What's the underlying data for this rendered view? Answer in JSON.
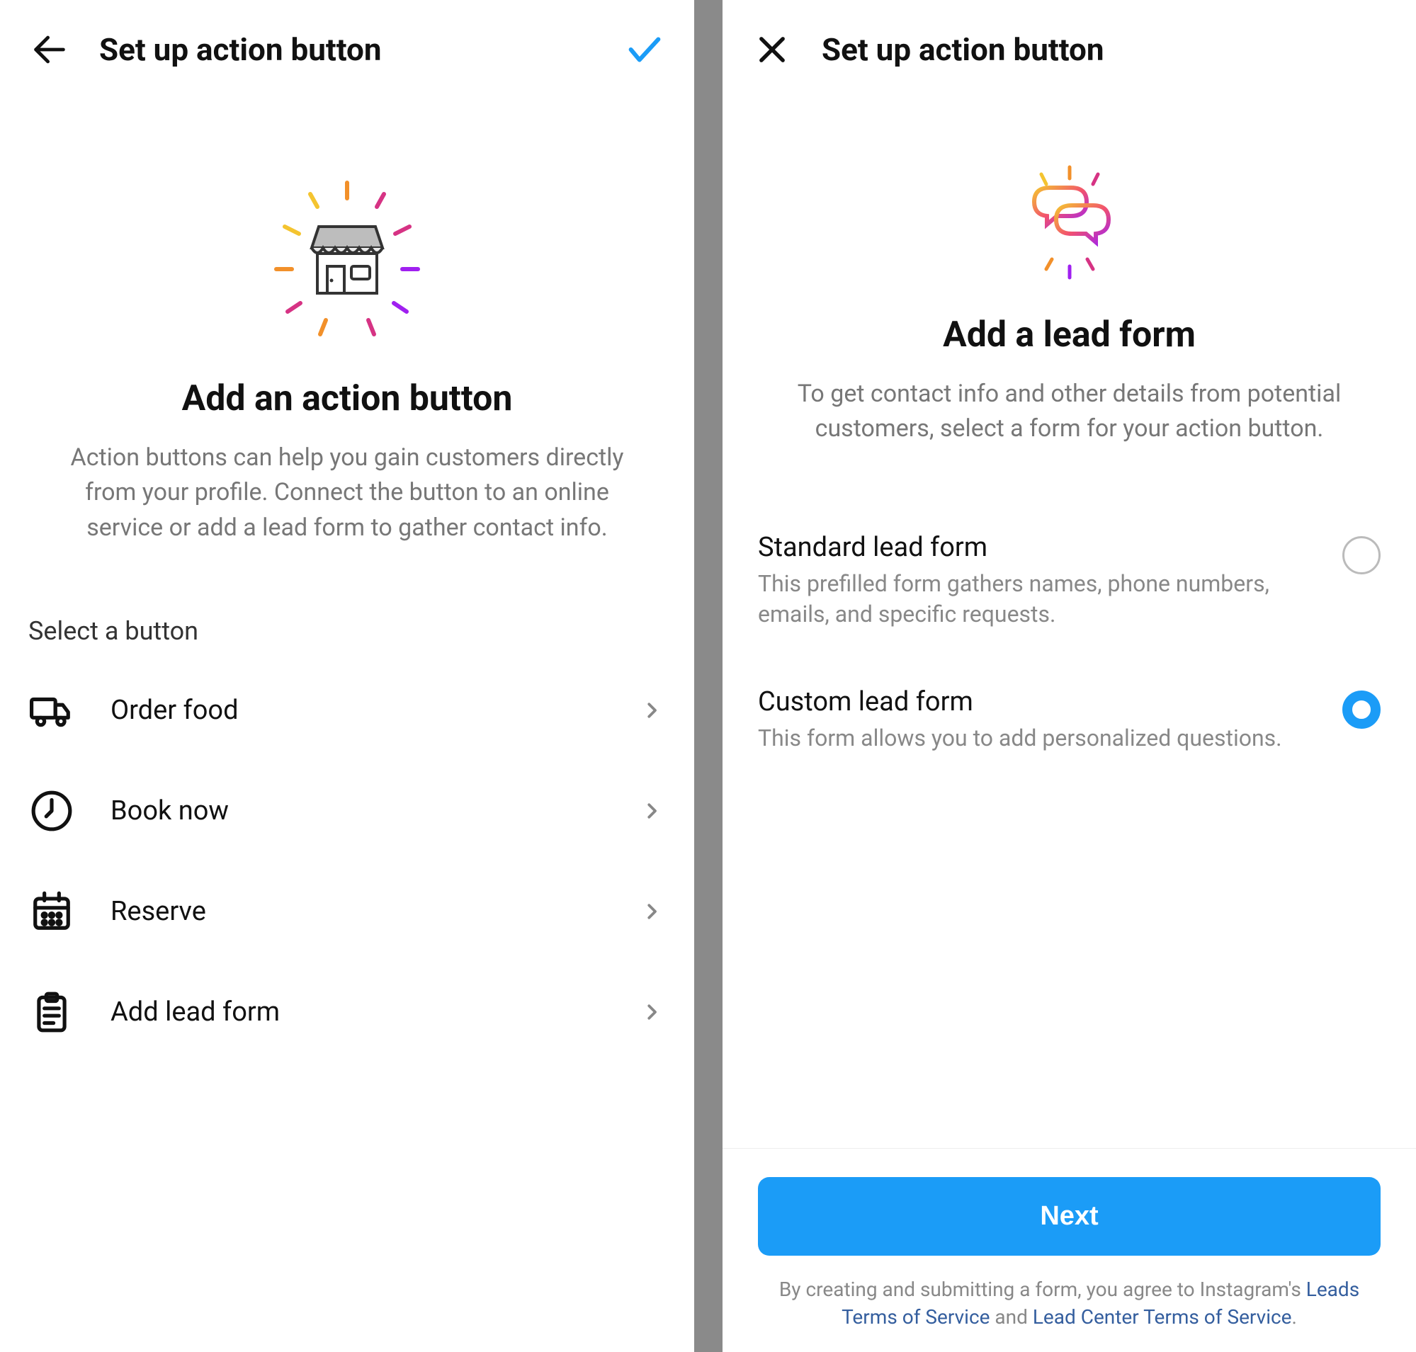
{
  "left": {
    "header_title": "Set up action button",
    "hero_title": "Add an action button",
    "hero_sub": "Action buttons can help you gain customers directly from your profile. Connect the button to an online service or add a lead form to gather contact info.",
    "section_label": "Select a button",
    "options": [
      {
        "label": "Order food"
      },
      {
        "label": "Book now"
      },
      {
        "label": "Reserve"
      },
      {
        "label": "Add lead form"
      }
    ]
  },
  "right": {
    "header_title": "Set up action button",
    "hero_title": "Add a lead form",
    "hero_sub": "To get contact info and other details from potential customers, select a form for your action button.",
    "forms": [
      {
        "title": "Standard lead form",
        "desc": "This prefilled form gathers names, phone numbers, emails, and specific requests.",
        "selected": false
      },
      {
        "title": "Custom lead form",
        "desc": "This form allows you to add personalized questions.",
        "selected": true
      }
    ],
    "next_label": "Next",
    "legal_prefix": "By creating and submitting a form, you agree to Instagram's ",
    "legal_link1": "Leads Terms of Service",
    "legal_mid": " and ",
    "legal_link2": "Lead Center Terms of Service",
    "legal_suffix": "."
  },
  "colors": {
    "accent": "#1b9cf7"
  }
}
